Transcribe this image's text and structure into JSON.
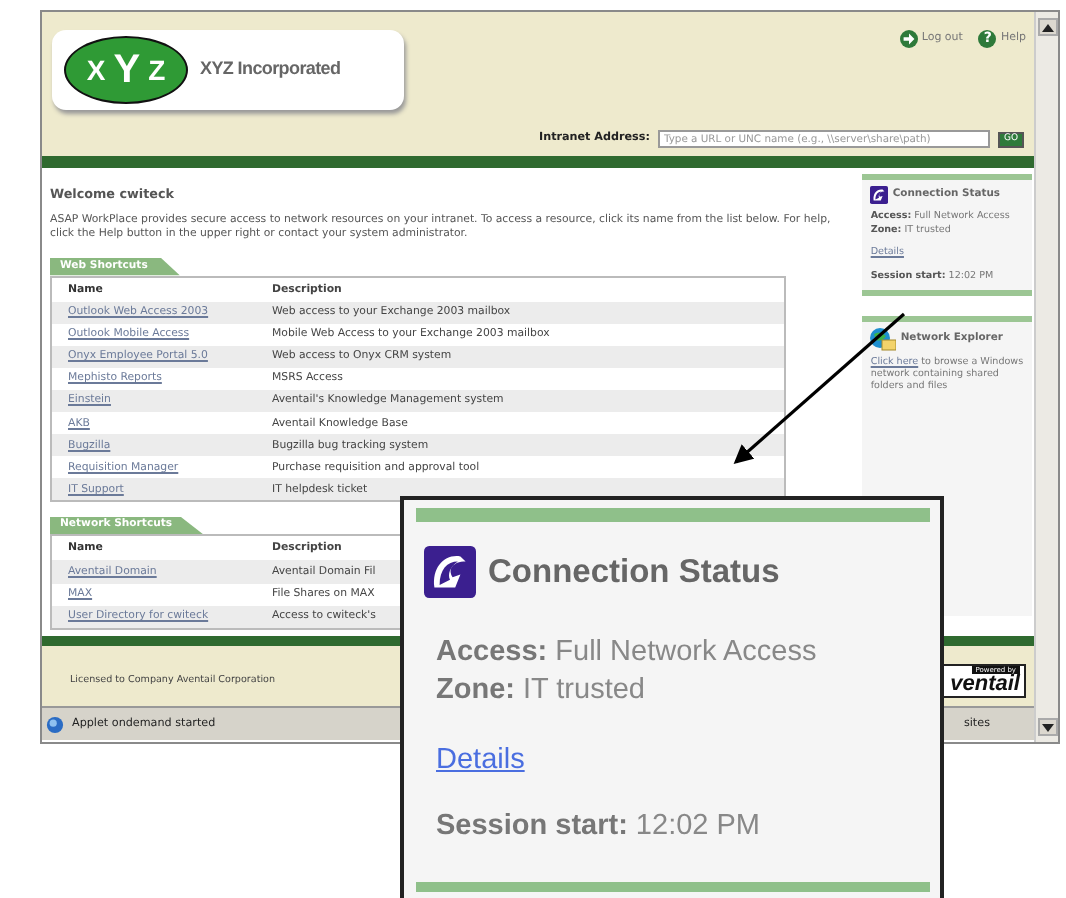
{
  "header": {
    "logo_letters": [
      "X",
      "Y",
      "Z"
    ],
    "company": "XYZ Incorporated",
    "top_links": [
      {
        "kind": "logout",
        "label": "Log out"
      },
      {
        "kind": "help",
        "glyph": "?",
        "label": "Help"
      }
    ],
    "intranet": {
      "label": "Intranet Address:",
      "placeholder": "Type a URL or UNC name (e.g., \\\\server\\share\\path)",
      "button": "GO"
    }
  },
  "main": {
    "welcome": "Welcome cwiteck",
    "intro": "ASAP WorkPlace provides secure access to network resources on your intranet. To access a resource, click its name from the list below. For help, click the Help button in the upper right or contact your system administrator.",
    "sections": [
      {
        "title": "Web Shortcuts",
        "columns": [
          "Name",
          "Description"
        ],
        "rows": [
          {
            "name": "Outlook Web Access 2003",
            "description": "Web access to your Exchange 2003 mailbox"
          },
          {
            "name": "Outlook Mobile Access",
            "description": "Mobile Web Access to your Exchange 2003 mailbox"
          },
          {
            "name": "Onyx Employee Portal 5.0",
            "description": "Web access to Onyx CRM system"
          },
          {
            "name": "Mephisto Reports",
            "description": "MSRS Access"
          },
          {
            "name": "Einstein",
            "description": "Aventail's Knowledge Management system"
          },
          {
            "name": "AKB",
            "description": "Aventail Knowledge Base"
          },
          {
            "name": "Bugzilla",
            "description": "Bugzilla bug tracking system"
          },
          {
            "name": "Requisition Manager",
            "description": "Purchase requisition and approval tool"
          },
          {
            "name": "IT Support",
            "description": "IT helpdesk ticket"
          }
        ]
      },
      {
        "title": "Network Shortcuts",
        "columns": [
          "Name",
          "Description"
        ],
        "rows": [
          {
            "name": "Aventail Domain",
            "description": "Aventail Domain Fil"
          },
          {
            "name": "MAX",
            "description": "File Shares on MAX"
          },
          {
            "name": "User Directory for cwiteck",
            "description": "Access to cwiteck's"
          }
        ]
      }
    ]
  },
  "sidebar": {
    "connection_status": {
      "title": "Connection Status",
      "access_label": "Access:",
      "access": "Full Network Access",
      "zone_label": "Zone:",
      "zone": "IT trusted",
      "details": "Details",
      "session_label": "Session start:",
      "session": "12:02 PM"
    },
    "network_explorer": {
      "title": "Network Explorer",
      "link": "Click here",
      "text": " to browse a Windows network containing shared folders and files"
    }
  },
  "footer": {
    "licensed": "Licensed to Company Aventail Corporation",
    "powered_by": "Powered by",
    "brand": "ventail"
  },
  "status_bar": {
    "message": "Applet ondemand started",
    "zone": "sites"
  },
  "callout": {
    "title": "Connection Status",
    "access_label": "Access:",
    "access": "Full Network Access",
    "zone_label": "Zone:",
    "zone": "IT trusted",
    "details": "Details",
    "session_label": "Session start:",
    "session": "12:02 PM"
  }
}
